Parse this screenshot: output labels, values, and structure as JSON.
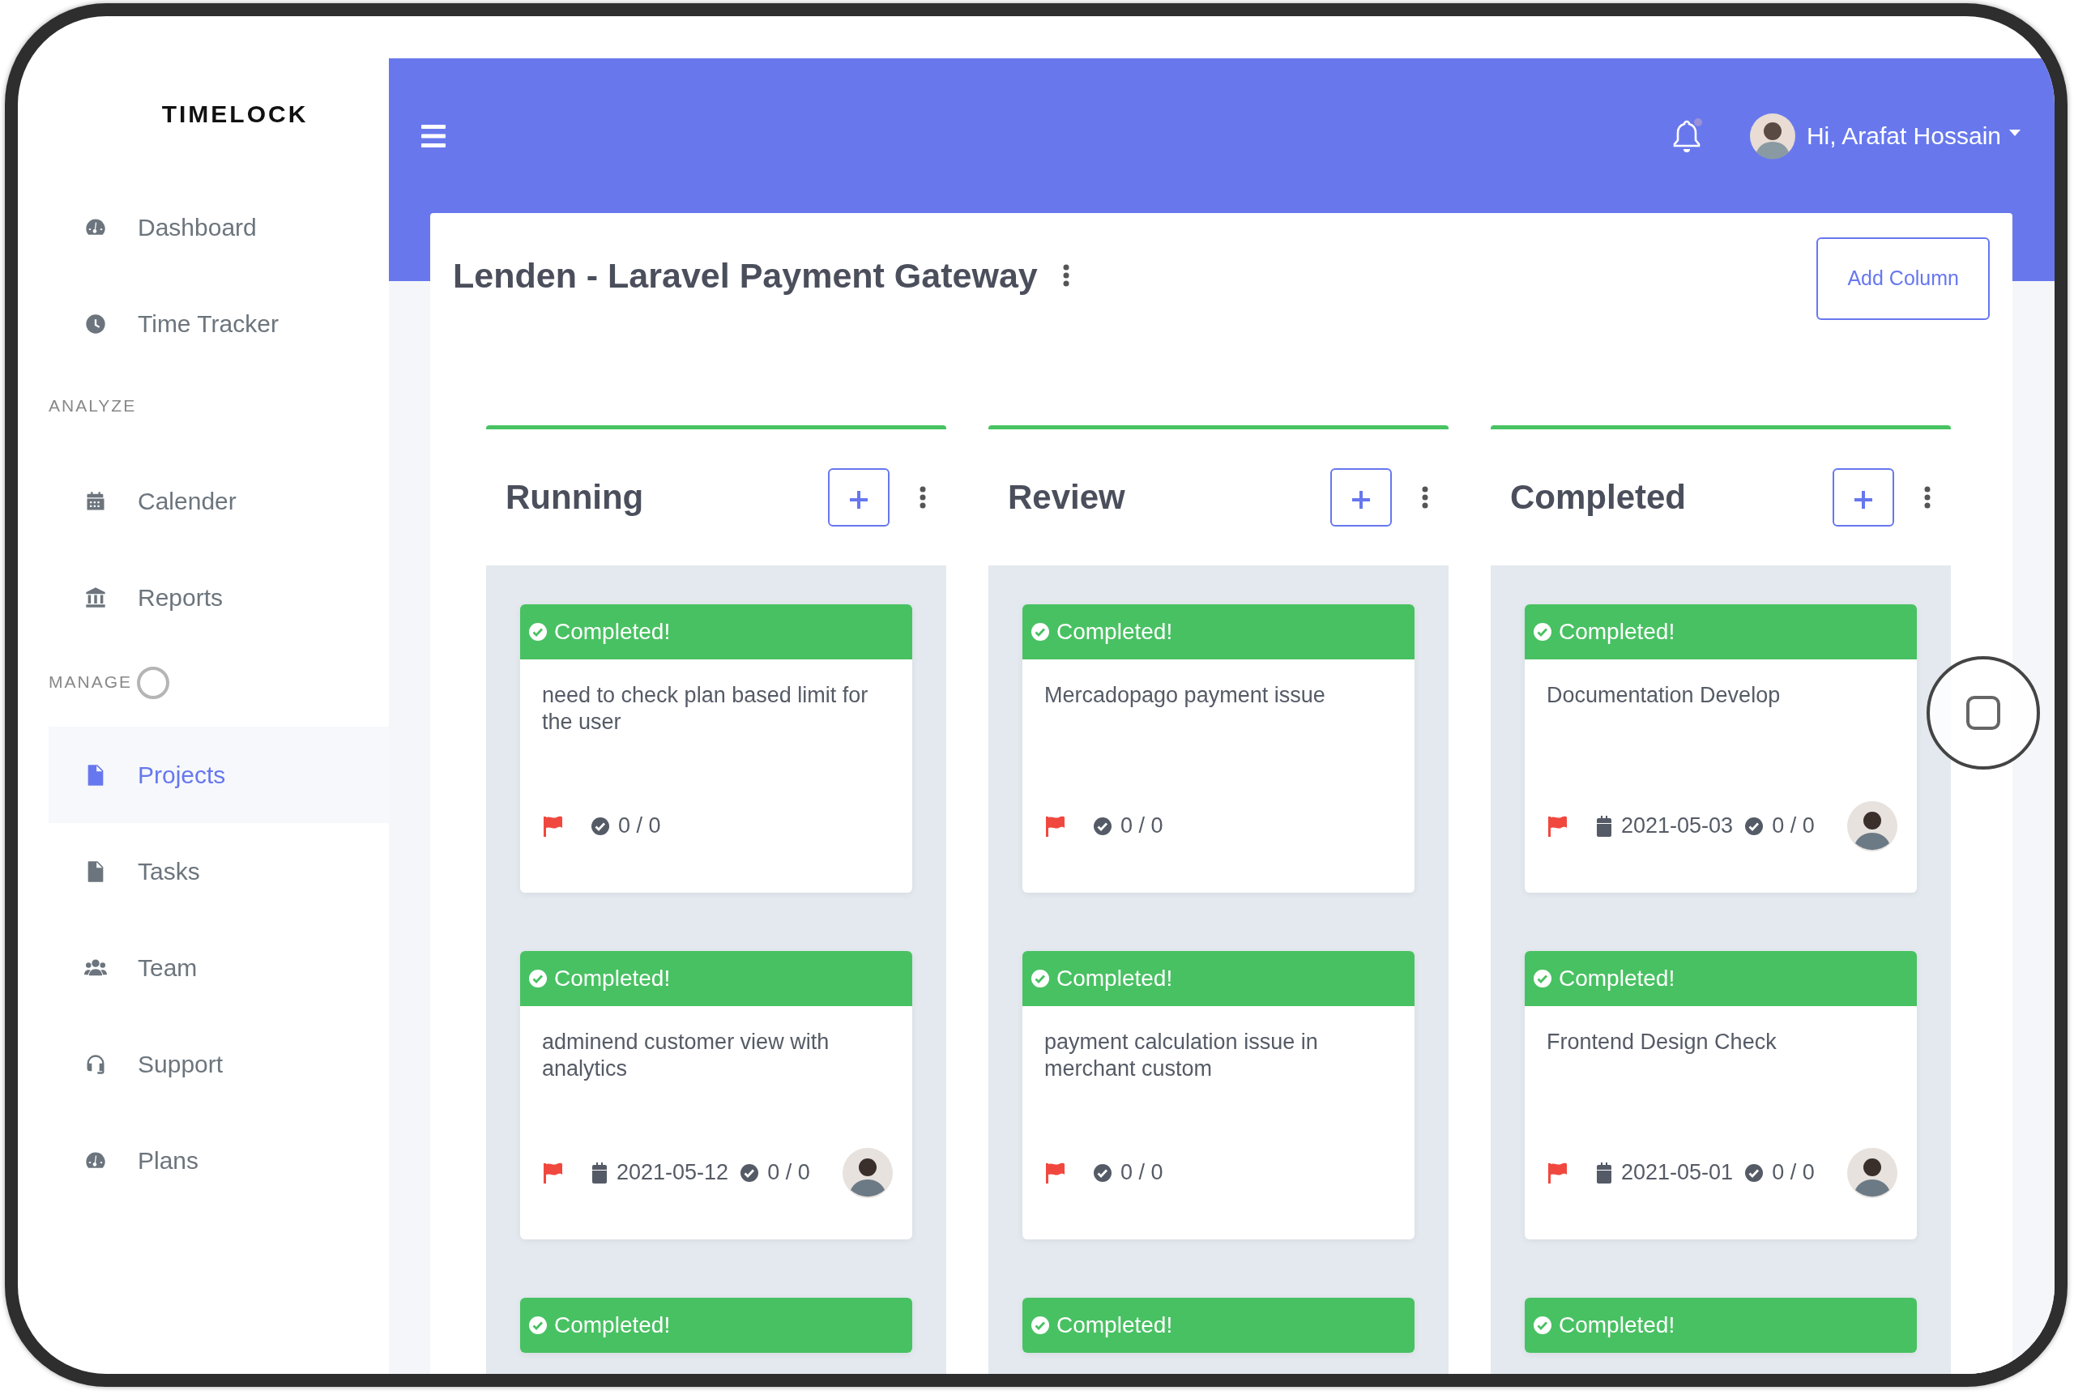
{
  "app": {
    "logo": "TIMELOCK"
  },
  "sidebar": {
    "items": [
      {
        "kind": "link",
        "label": "Dashboard",
        "selected": false
      },
      {
        "kind": "link",
        "label": "Time Tracker",
        "selected": false
      },
      {
        "kind": "heading",
        "label": "ANALYZE"
      },
      {
        "kind": "link",
        "label": "Calender",
        "selected": false
      },
      {
        "kind": "link",
        "label": "Reports",
        "selected": false
      },
      {
        "kind": "heading",
        "label": "MANAGE"
      },
      {
        "kind": "link",
        "label": "Projects",
        "selected": true
      },
      {
        "kind": "link",
        "label": "Tasks",
        "selected": false
      },
      {
        "kind": "link",
        "label": "Team",
        "selected": false
      },
      {
        "kind": "link",
        "label": "Support",
        "selected": false
      },
      {
        "kind": "link",
        "label": "Plans",
        "selected": false
      }
    ]
  },
  "topbar": {
    "notifications_unread": true,
    "user_greeting": "Hi, Arafat Hossain"
  },
  "project": {
    "title": "Lenden - Laravel Payment Gateway",
    "add_button": "Add Column"
  },
  "columns": [
    {
      "title": "Running",
      "cards": [
        {
          "status": "Completed!",
          "text": "need to check plan based limit for the user",
          "progress": "0 / 0",
          "has_avatar": false
        },
        {
          "status": "Completed!",
          "text": "adminend customer view with analytics",
          "due": "2021-05-12",
          "progress": "0 / 0",
          "has_avatar": true
        },
        {
          "status": "Completed!"
        }
      ]
    },
    {
      "title": "Review",
      "cards": [
        {
          "status": "Completed!",
          "text": "Mercadopago payment issue",
          "progress": "0 / 0",
          "has_avatar": false
        },
        {
          "status": "Completed!",
          "text": "payment calculation issue in merchant custom",
          "progress": "0 / 0",
          "has_avatar": false
        },
        {
          "status": "Completed!"
        }
      ]
    },
    {
      "title": "Completed",
      "cards": [
        {
          "status": "Completed!",
          "text": "Documentation Develop",
          "due": "2021-05-03",
          "progress": "0 / 0",
          "has_avatar": true
        },
        {
          "status": "Completed!",
          "text": "Frontend Design Check",
          "due": "2021-05-01",
          "progress": "0 / 0",
          "has_avatar": true
        },
        {
          "status": "Completed!"
        }
      ]
    }
  ]
}
